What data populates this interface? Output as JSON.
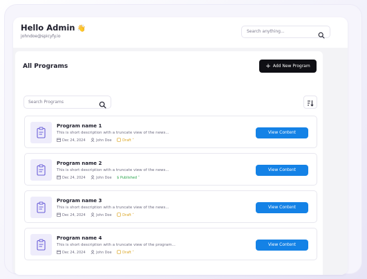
{
  "header": {
    "greeting": "Hello Admin",
    "wave_icon": "waving-hand-icon",
    "email": "johndoe@spicyfy.io",
    "search_placeholder": "Search anything..."
  },
  "panel": {
    "title": "All Programs",
    "add_button_label": "Add New Program",
    "search_placeholder": "Search Programs",
    "sort_icon": "sort-icon"
  },
  "programs": [
    {
      "name": "Program name 1",
      "description": "This is short description with a truncate view of the news...",
      "date": "Dec 24, 2024",
      "author": "John Doe",
      "status": "Draft",
      "action_label": "View Content"
    },
    {
      "name": "Program name 2",
      "description": "This is short description with a truncate view of the news...",
      "date": "Dec 24, 2024",
      "author": "John Doe",
      "status": "Published",
      "action_label": "View Content"
    },
    {
      "name": "Program name 3",
      "description": "This is short description with a truncate view of the news...",
      "date": "Dec 24, 2024",
      "author": "John Doe",
      "status": "Draft",
      "action_label": "View Content"
    },
    {
      "name": "Program name 4",
      "description": "This is short description with a truncate view of the program...",
      "date": "Dec 24, 2024",
      "author": "John Doe",
      "status": "Draft",
      "action_label": "View Content"
    }
  ],
  "colors": {
    "accent": "#1482e6",
    "primary_button": "#0f0f14",
    "draft": "#d9a21c",
    "published": "#27a34a",
    "thumb_bg": "#eeecfb"
  }
}
